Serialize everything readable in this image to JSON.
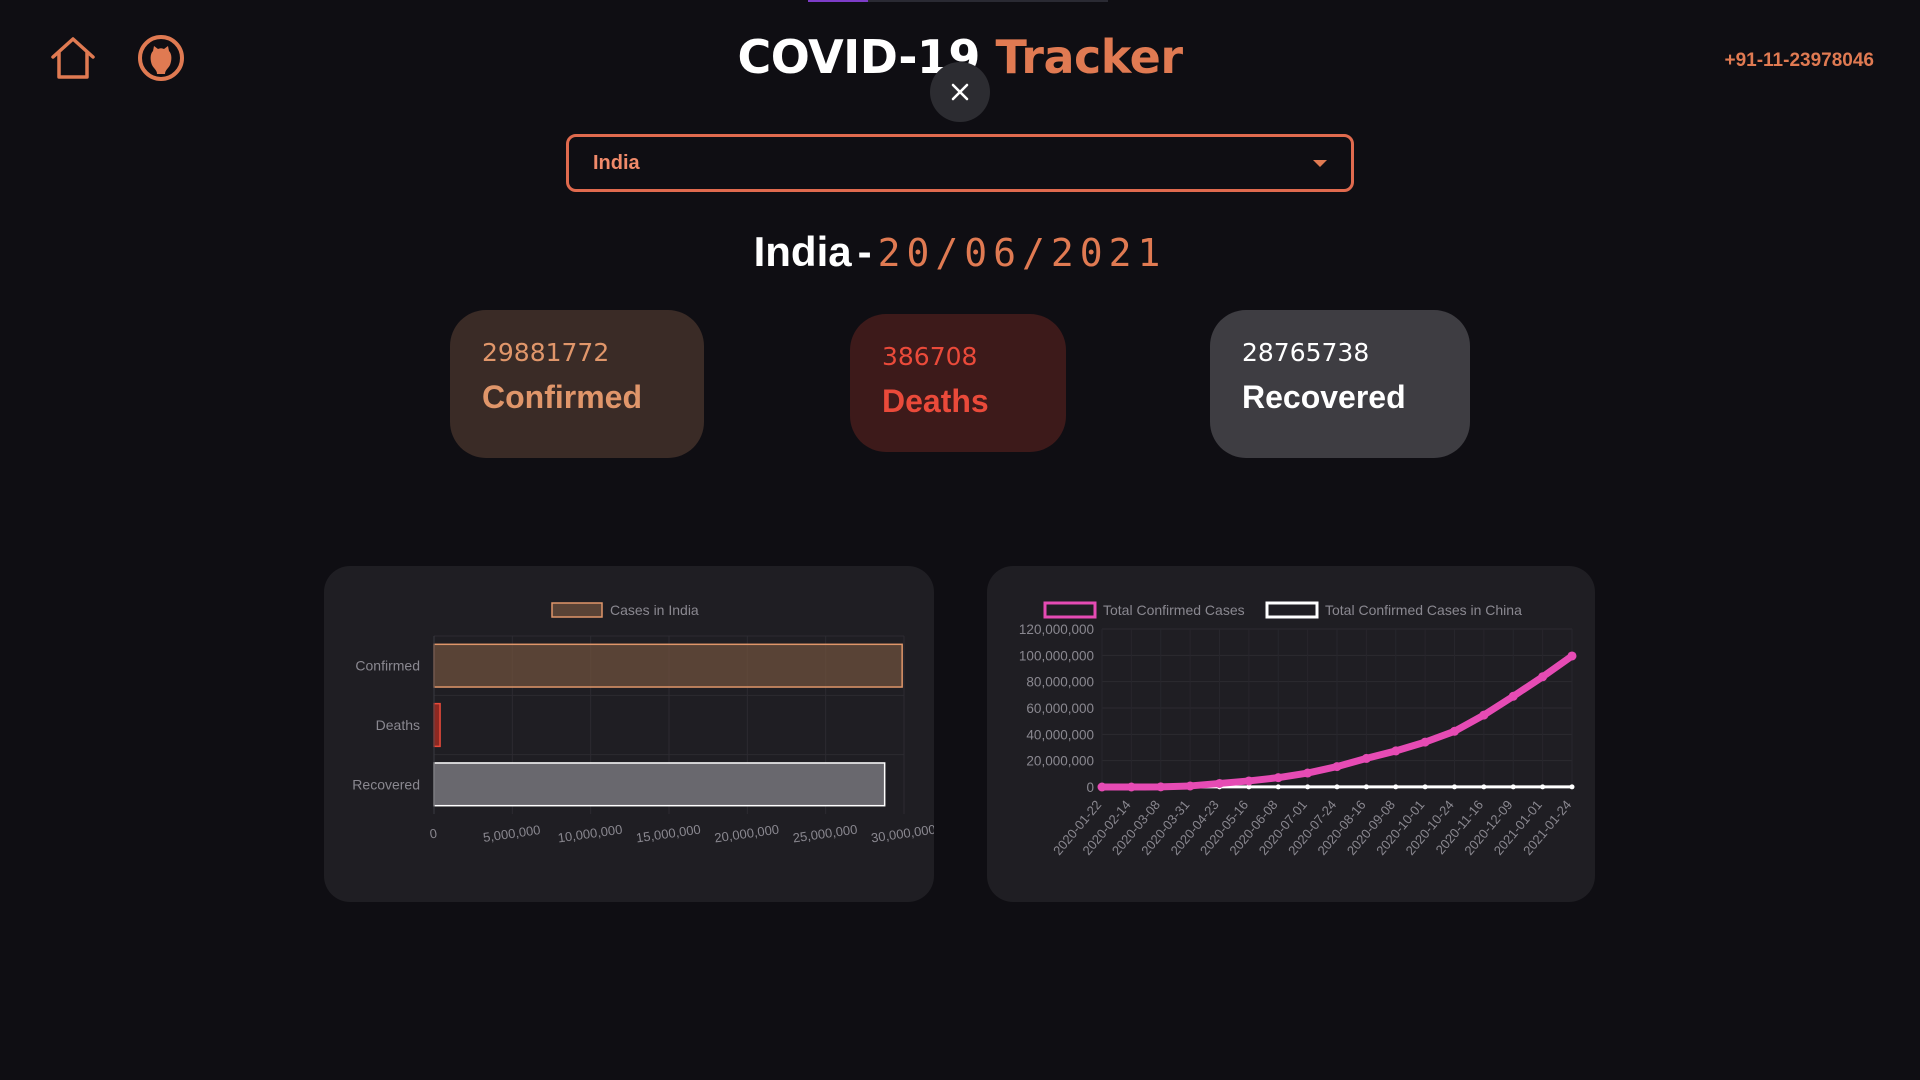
{
  "header": {
    "title_part1": "COVID-19",
    "title_part2": "Tracker",
    "phone": "+91-11-23978046",
    "icons": {
      "home": "home-icon",
      "github": "github-icon",
      "close": "close-icon"
    }
  },
  "selector": {
    "value": "India"
  },
  "heading": {
    "country": "India",
    "separator": "-",
    "date": "20/06/2021"
  },
  "stats": [
    {
      "value": "29881772",
      "label": "Confirmed"
    },
    {
      "value": "386708",
      "label": "Deaths"
    },
    {
      "value": "28765738",
      "label": "Recovered"
    }
  ],
  "colors": {
    "accent": "#e07a52",
    "confirmed": "#e0966a",
    "deaths": "#ea4a3a",
    "recovered": "#ffffff",
    "line_primary": "#e64bb4",
    "line_secondary": "#ffffff"
  },
  "chart_data": [
    {
      "type": "bar",
      "orientation": "horizontal",
      "categories": [
        "Confirmed",
        "Deaths",
        "Recovered"
      ],
      "series": [
        {
          "name": "Cases in India",
          "values": [
            29881772,
            386708,
            28765738
          ]
        }
      ],
      "xlim": [
        0,
        30000000
      ],
      "x_ticks": [
        "0",
        "5,000,000",
        "10,000,000",
        "15,000,000",
        "20,000,000",
        "25,000,000",
        "30,000,000"
      ],
      "legend": "top",
      "grid": true
    },
    {
      "type": "line",
      "x_ticks": [
        "2020-01-22",
        "2020-02-14",
        "2020-03-08",
        "2020-03-31",
        "2020-04-23",
        "2020-05-16",
        "2020-06-08",
        "2020-07-01",
        "2020-07-24",
        "2020-08-16",
        "2020-09-08",
        "2020-10-01",
        "2020-10-24",
        "2020-11-16",
        "2020-12-09",
        "2021-01-01",
        "2021-01-24"
      ],
      "ylim": [
        0,
        120000000
      ],
      "y_ticks": [
        "0",
        "20,000,000",
        "40,000,000",
        "60,000,000",
        "80,000,000",
        "100,000,000",
        "120,000,000"
      ],
      "series": [
        {
          "name": "Total Confirmed Cases",
          "values": [
            0,
            0,
            100000,
            800000,
            2700000,
            4600000,
            7100000,
            10600000,
            15500000,
            21700000,
            27400000,
            34100000,
            42300000,
            54600000,
            68900000,
            83700000,
            99500000
          ]
        },
        {
          "name": "Total Confirmed Cases in China",
          "values": [
            500,
            60000,
            81000,
            82300,
            82900,
            83000,
            84000,
            84800,
            86000,
            89000,
            90000,
            90600,
            91000,
            91900,
            94600,
            96700,
            100000
          ]
        }
      ],
      "legend": "top",
      "grid": true
    }
  ]
}
